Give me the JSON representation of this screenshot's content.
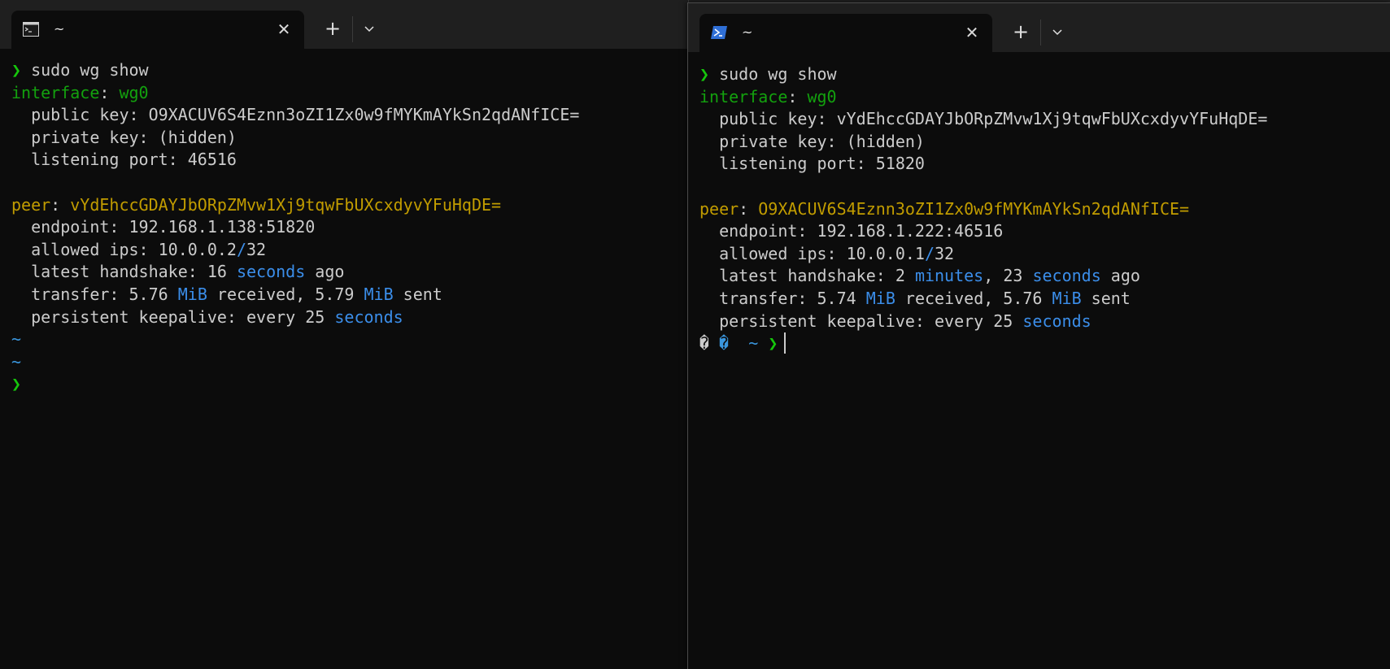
{
  "left": {
    "tab_title": "~",
    "tab_icon": "cmd-terminal-icon",
    "lines": [
      [
        {
          "t": "❯ ",
          "c": "pg"
        },
        {
          "t": "sudo wg show",
          "c": ""
        }
      ],
      [
        {
          "t": "interface",
          "c": "g"
        },
        {
          "t": ": ",
          "c": ""
        },
        {
          "t": "wg0",
          "c": "g"
        }
      ],
      [
        {
          "t": "  public key",
          "c": ""
        },
        {
          "t": ": ",
          "c": ""
        },
        {
          "t": "O9XACUV6S4Eznn3oZI1Zx0w9fMYKmAYkSn2qdANfICE=",
          "c": ""
        }
      ],
      [
        {
          "t": "  private key",
          "c": ""
        },
        {
          "t": ": ",
          "c": ""
        },
        {
          "t": "(hidden)",
          "c": ""
        }
      ],
      [
        {
          "t": "  listening port",
          "c": ""
        },
        {
          "t": ": ",
          "c": ""
        },
        {
          "t": "46516",
          "c": ""
        }
      ],
      [],
      [
        {
          "t": "peer",
          "c": "y"
        },
        {
          "t": ": ",
          "c": ""
        },
        {
          "t": "vYdEhccGDAYJbORpZMvw1Xj9tqwFbUXcxdyvYFuHqDE=",
          "c": "y"
        }
      ],
      [
        {
          "t": "  endpoint",
          "c": ""
        },
        {
          "t": ": ",
          "c": ""
        },
        {
          "t": "192.168.1.138:51820",
          "c": ""
        }
      ],
      [
        {
          "t": "  allowed ips",
          "c": ""
        },
        {
          "t": ": ",
          "c": ""
        },
        {
          "t": "10.0.0.2",
          "c": ""
        },
        {
          "t": "/",
          "c": "b"
        },
        {
          "t": "32",
          "c": ""
        }
      ],
      [
        {
          "t": "  latest handshake",
          "c": ""
        },
        {
          "t": ": ",
          "c": ""
        },
        {
          "t": "16 ",
          "c": ""
        },
        {
          "t": "seconds",
          "c": "b"
        },
        {
          "t": " ago",
          "c": ""
        }
      ],
      [
        {
          "t": "  transfer",
          "c": ""
        },
        {
          "t": ": ",
          "c": ""
        },
        {
          "t": "5.76 ",
          "c": ""
        },
        {
          "t": "MiB",
          "c": "b"
        },
        {
          "t": " received, 5.79 ",
          "c": ""
        },
        {
          "t": "MiB",
          "c": "b"
        },
        {
          "t": " sent",
          "c": ""
        }
      ],
      [
        {
          "t": "  persistent keepalive",
          "c": ""
        },
        {
          "t": ": ",
          "c": ""
        },
        {
          "t": "every 25 ",
          "c": ""
        },
        {
          "t": "seconds",
          "c": "b"
        }
      ],
      [
        {
          "t": "~",
          "c": "c"
        }
      ],
      [
        {
          "t": "~",
          "c": "c"
        }
      ],
      [
        {
          "t": "❯",
          "c": "pg"
        }
      ]
    ]
  },
  "right": {
    "tab_title": "~",
    "tab_icon": "powershell-icon",
    "lines": [
      [
        {
          "t": "❯ ",
          "c": "pg"
        },
        {
          "t": "sudo wg show",
          "c": ""
        }
      ],
      [
        {
          "t": "interface",
          "c": "g"
        },
        {
          "t": ": ",
          "c": ""
        },
        {
          "t": "wg0",
          "c": "g"
        }
      ],
      [
        {
          "t": "  public key",
          "c": ""
        },
        {
          "t": ": ",
          "c": ""
        },
        {
          "t": "vYdEhccGDAYJbORpZMvw1Xj9tqwFbUXcxdyvYFuHqDE=",
          "c": ""
        }
      ],
      [
        {
          "t": "  private key",
          "c": ""
        },
        {
          "t": ": ",
          "c": ""
        },
        {
          "t": "(hidden)",
          "c": ""
        }
      ],
      [
        {
          "t": "  listening port",
          "c": ""
        },
        {
          "t": ": ",
          "c": ""
        },
        {
          "t": "51820",
          "c": ""
        }
      ],
      [],
      [
        {
          "t": "peer",
          "c": "y"
        },
        {
          "t": ": ",
          "c": ""
        },
        {
          "t": "O9XACUV6S4Eznn3oZI1Zx0w9fMYKmAYkSn2qdANfICE=",
          "c": "y"
        }
      ],
      [
        {
          "t": "  endpoint",
          "c": ""
        },
        {
          "t": ": ",
          "c": ""
        },
        {
          "t": "192.168.1.222:46516",
          "c": ""
        }
      ],
      [
        {
          "t": "  allowed ips",
          "c": ""
        },
        {
          "t": ": ",
          "c": ""
        },
        {
          "t": "10.0.0.1",
          "c": ""
        },
        {
          "t": "/",
          "c": "b"
        },
        {
          "t": "32",
          "c": ""
        }
      ],
      [
        {
          "t": "  latest handshake",
          "c": ""
        },
        {
          "t": ": ",
          "c": ""
        },
        {
          "t": "2 ",
          "c": ""
        },
        {
          "t": "minutes",
          "c": "b"
        },
        {
          "t": ", 23 ",
          "c": ""
        },
        {
          "t": "seconds",
          "c": "b"
        },
        {
          "t": " ago",
          "c": ""
        }
      ],
      [
        {
          "t": "  transfer",
          "c": ""
        },
        {
          "t": ": ",
          "c": ""
        },
        {
          "t": "5.74 ",
          "c": ""
        },
        {
          "t": "MiB",
          "c": "b"
        },
        {
          "t": " received, 5.76 ",
          "c": ""
        },
        {
          "t": "MiB",
          "c": "b"
        },
        {
          "t": " sent",
          "c": ""
        }
      ],
      [
        {
          "t": "  persistent keepalive",
          "c": ""
        },
        {
          "t": ": ",
          "c": ""
        },
        {
          "t": "every 25 ",
          "c": ""
        },
        {
          "t": "seconds",
          "c": "b"
        }
      ],
      [
        {
          "t": "� ",
          "c": ""
        },
        {
          "t": "� ",
          "c": "c"
        },
        {
          "t": " ~ ",
          "c": "c"
        },
        {
          "t": "❯",
          "c": "pg"
        }
      ]
    ]
  },
  "controls": {
    "close_glyph": "✕",
    "new_tab_glyph": "+"
  },
  "colors": {
    "background": "#0c0c0c",
    "titlebar": "#1f1f1f",
    "green": "#13a10e",
    "prompt_green": "#16c60c",
    "yellow": "#c19c00",
    "blue": "#3b8eea",
    "cyan": "#3a96dd"
  }
}
